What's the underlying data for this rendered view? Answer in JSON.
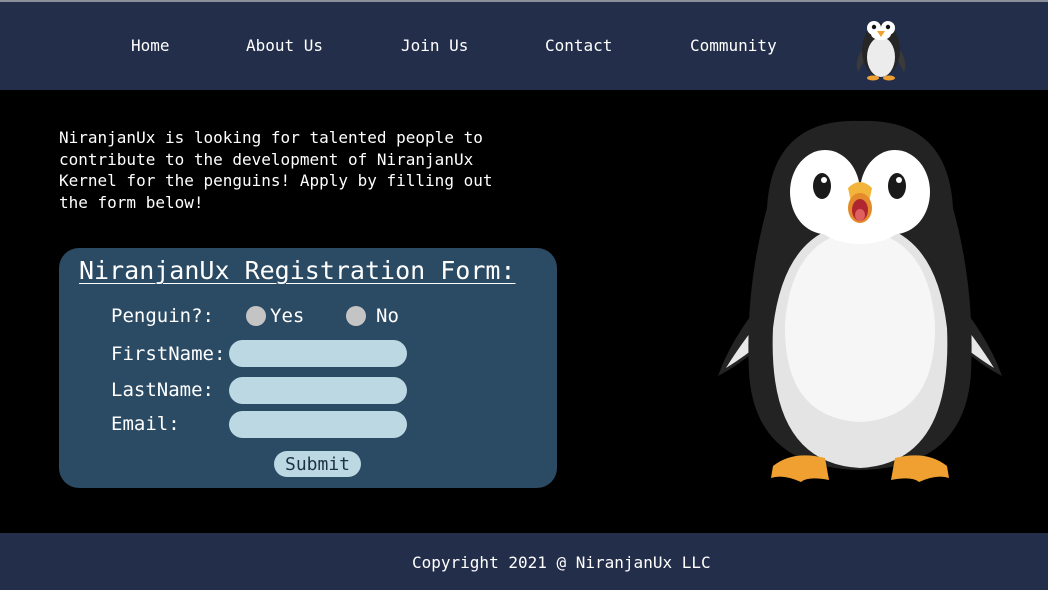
{
  "nav": {
    "items": [
      {
        "label": "Home"
      },
      {
        "label": "About Us"
      },
      {
        "label": "Join Us"
      },
      {
        "label": "Contact"
      },
      {
        "label": "Community"
      }
    ],
    "logo_icon": "penguin-icon"
  },
  "intro": {
    "text": "NiranjanUx is looking for talented people to contribute to the development of NiranjanUx Kernel for the penguins! Apply by filling out the form below!"
  },
  "form": {
    "title": "NiranjanUx Registration Form:",
    "penguin_label": "Penguin?:",
    "options": {
      "yes": "Yes",
      "no": "No"
    },
    "firstname_label": "FirstName:",
    "lastname_label": "LastName:",
    "email_label": "Email:",
    "firstname_value": "",
    "lastname_value": "",
    "email_value": "",
    "submit_label": "Submit"
  },
  "footer": {
    "copyright": "Copyright 2021 @ NiranjanUx LLC"
  },
  "colors": {
    "nav_bg": "#232e4a",
    "form_bg": "#2b4a64",
    "field_bg": "#bcd8e2",
    "page_bg": "#000000"
  }
}
